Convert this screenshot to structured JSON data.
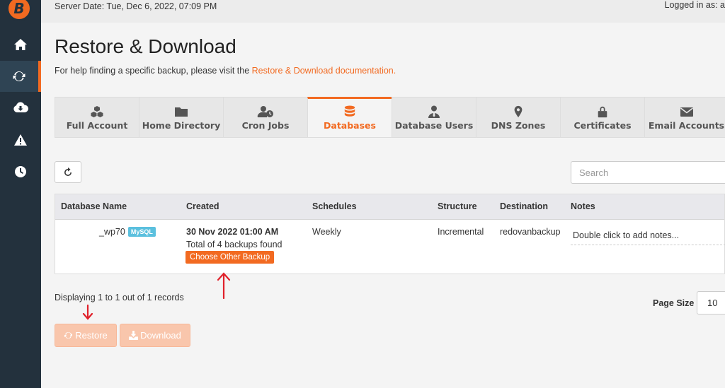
{
  "app": {
    "logo_letter": "B",
    "accent_color": "#f26a21"
  },
  "sidebar": {
    "items": [
      {
        "icon": "home-icon",
        "active": false
      },
      {
        "icon": "refresh-icon",
        "active": true
      },
      {
        "icon": "cloud-download-icon",
        "active": false
      },
      {
        "icon": "warning-icon",
        "active": false
      },
      {
        "icon": "clock-icon",
        "active": false
      }
    ]
  },
  "topbar": {
    "server_date": "Server Date: Tue, Dec 6, 2022, 07:09 PM",
    "logged_in": "Logged in as: a"
  },
  "page": {
    "title": "Restore & Download",
    "help_text": "For help finding a specific backup, please visit the ",
    "help_link": "Restore & Download documentation."
  },
  "tabs": [
    {
      "label": "Full Account",
      "icon": "cubes-icon",
      "active": false
    },
    {
      "label": "Home Directory",
      "icon": "folder-icon",
      "active": false
    },
    {
      "label": "Cron Jobs",
      "icon": "user-clock-icon",
      "active": false
    },
    {
      "label": "Databases",
      "icon": "database-icon",
      "active": true
    },
    {
      "label": "Database Users",
      "icon": "user-tie-icon",
      "active": false
    },
    {
      "label": "DNS Zones",
      "icon": "map-marker-icon",
      "active": false
    },
    {
      "label": "Certificates",
      "icon": "lock-icon",
      "active": false
    },
    {
      "label": "Email Accounts",
      "icon": "envelope-icon",
      "active": false
    }
  ],
  "search": {
    "placeholder": "Search"
  },
  "table": {
    "headers": {
      "name": "Database Name",
      "created": "Created",
      "schedules": "Schedules",
      "structure": "Structure",
      "destination": "Destination",
      "notes": "Notes"
    },
    "rows": [
      {
        "name": "_wp70",
        "badge": "MySQL",
        "created_date": "30 Nov 2022 01:00 AM",
        "backups_found": "Total of 4 backups found",
        "choose_label": "Choose Other Backup",
        "schedule": "Weekly",
        "structure": "Incremental",
        "destination": "redovanbackup",
        "notes": "Double click to add notes..."
      }
    ]
  },
  "footer": {
    "records": "Displaying 1 to 1 out of 1 records",
    "page_size_label": "Page Size",
    "page_size_value": "10",
    "restore_label": "Restore",
    "download_label": "Download"
  },
  "annotations": {
    "arrow_color": "#e0202a"
  }
}
